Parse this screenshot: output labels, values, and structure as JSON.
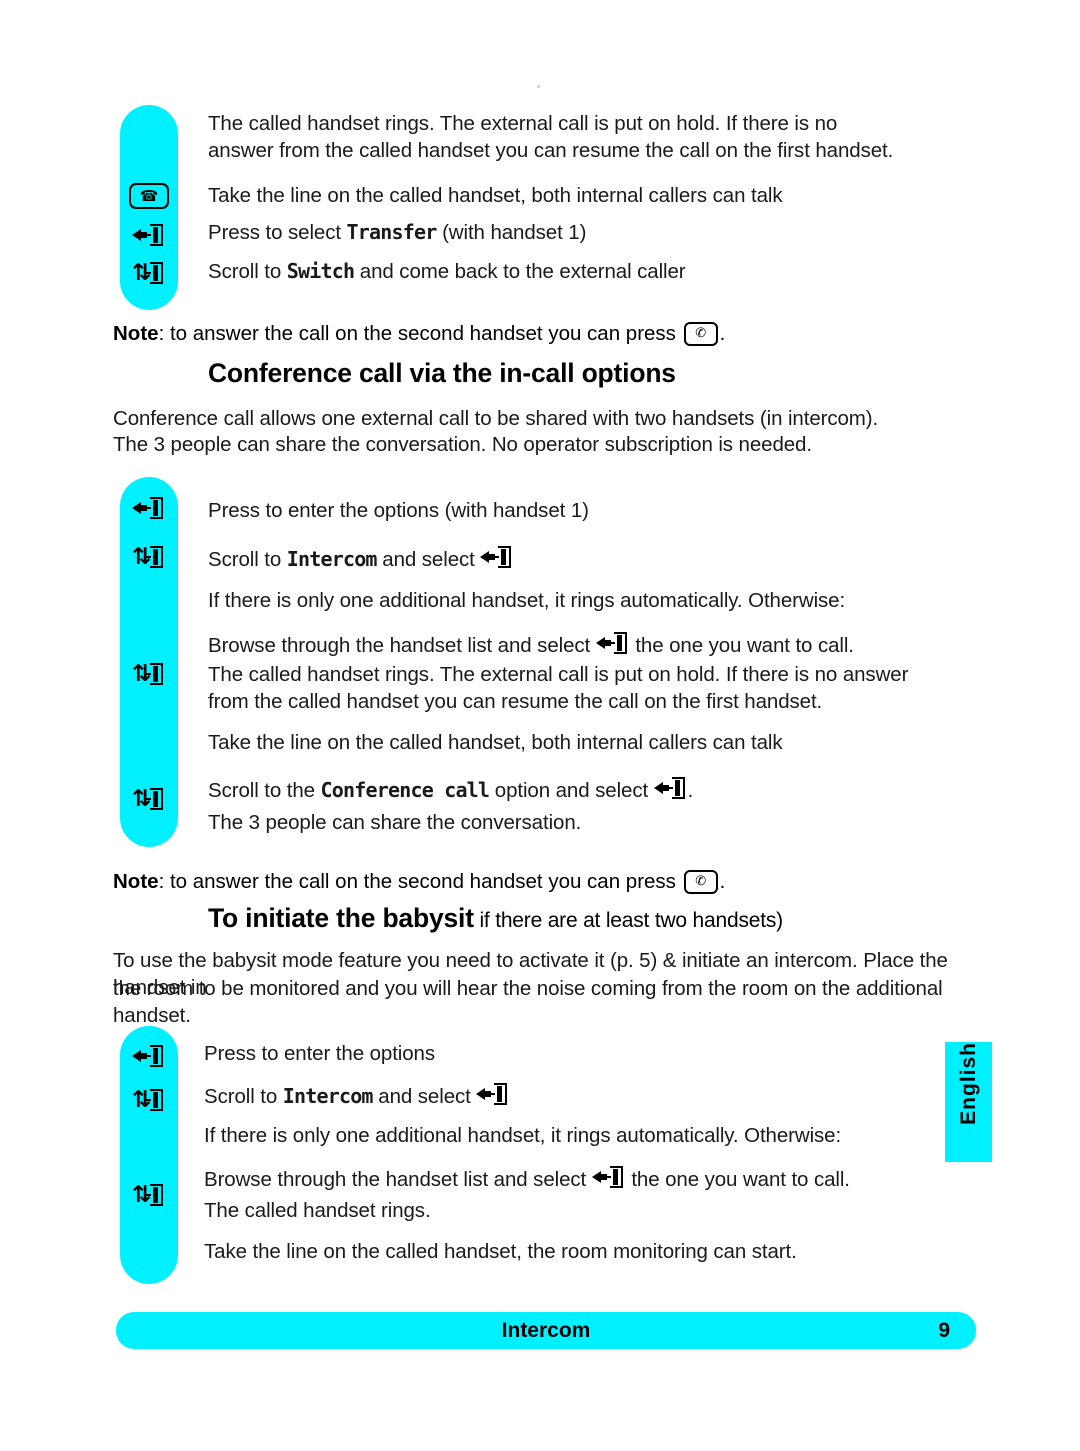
{
  "page": {
    "language_tab": "English",
    "footer_title": "Intercom",
    "footer_page_number": "9",
    "accent_color": "#00f0ff"
  },
  "sections": [
    {
      "id": "transfer-steps",
      "lines": [
        {
          "text_before": "The called handset rings. The external call is put on hold. If there is no answer from the called handset you can resume the call on the first handset.",
          "icon": null
        },
        {
          "text_before": "Take the line on the called handset, both internal callers can talk",
          "icon": "talk-key-icon"
        },
        {
          "text_before": "Press to select ",
          "lcd": "Transfer",
          "text_after": " (with handset 1)",
          "icon": "select-key-icon"
        },
        {
          "text_before": "Scroll to ",
          "lcd": "Switch",
          "text_after": " and come back to the external caller",
          "icon": "scroll-key-icon"
        }
      ]
    }
  ],
  "note1": {
    "label": "Note",
    "text_before": ": to answer the call on the second handset you can press ",
    "icon": "handsfree-key-icon",
    "text_after": "."
  },
  "heading_conference": {
    "title": "Conference call via the in-call options"
  },
  "intro_conference": {
    "line1": "Conference call allows one external call to be shared with two handsets (in intercom).",
    "line2": "The 3 people can share the conversation. No operator subscription is needed."
  },
  "conference_steps": [
    {
      "icon": "select-key-icon",
      "text_before": "Press to enter the options (with handset 1)"
    },
    {
      "icon": "scroll-key-icon",
      "text_before": "Scroll to ",
      "lcd": "Intercom",
      "text_after": " and select ",
      "inline_icon": "select-key-icon"
    },
    {
      "icon": null,
      "text_before": "If there is only one additional handset, it rings automatically. Otherwise:"
    },
    {
      "icon": "scroll-key-icon",
      "text_before": "Browse through the handset list and select ",
      "inline_icon": "select-key-icon",
      "text_after": " the one you want to call."
    },
    {
      "icon": null,
      "text_before": "The called handset rings. The external call is put on hold. If there is no answer"
    },
    {
      "icon": null,
      "text_before": "from the called handset you can resume the call on the first handset."
    },
    {
      "icon": null,
      "text_before": "Take the line on the called handset, both internal callers can talk"
    },
    {
      "icon": "scroll-key-icon",
      "text_before": "Scroll to the ",
      "lcd": "Conference call",
      "text_after": " option and select ",
      "inline_icon": "select-key-icon",
      "text_end": "."
    },
    {
      "icon": null,
      "text_before": "The 3 people can share the conversation."
    }
  ],
  "note2": {
    "label": "Note",
    "text_before": ": to answer the call on the second handset you can press ",
    "icon": "handsfree-key-icon",
    "text_after": "."
  },
  "heading_babysit": {
    "title": "To initiate the babysit",
    "subtitle": " if there are at least two handsets)"
  },
  "intro_babysit": {
    "line1": "To use the babysit mode feature you need to activate it (p. 5) & initiate an intercom. Place the handset in",
    "line2": "the room to be monitored and you will hear the noise coming from the room on the additional handset."
  },
  "babysit_steps": [
    {
      "icon": "select-key-icon",
      "text_before": "Press to enter the options"
    },
    {
      "icon": "scroll-key-icon",
      "text_before": "Scroll to ",
      "lcd": "Intercom",
      "text_after": " and select ",
      "inline_icon": "select-key-icon"
    },
    {
      "icon": null,
      "text_before": "If there is only one additional handset, it rings automatically. Otherwise:"
    },
    {
      "icon": "scroll-key-icon",
      "text_before": "Browse through the handset list and select ",
      "inline_icon": "select-key-icon",
      "text_after": " the one you want to call."
    },
    {
      "icon": null,
      "text_before": "The called handset rings."
    },
    {
      "icon": null,
      "text_before": "Take the line on the called handset, the room monitoring can start."
    }
  ]
}
